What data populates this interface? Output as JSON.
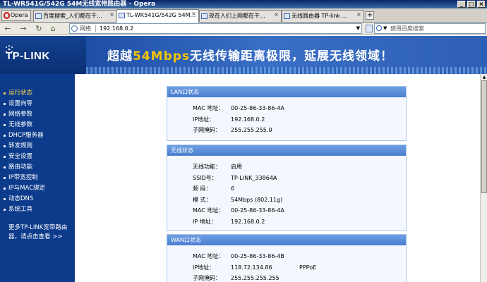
{
  "window": {
    "title": "TL-WR541G/542G 54M无线宽带路由器 - Opera"
  },
  "browser": {
    "opera_button": "Opera",
    "tabs": [
      {
        "label": "百度搜索_人们都在千..."
      },
      {
        "label": "TL-WR541G/542G 54M..."
      },
      {
        "label": "现在人们上网都在干..."
      },
      {
        "label": "无线路由器 TP-link ..."
      }
    ],
    "address": {
      "label": "网络",
      "url": "192.168.0.2"
    },
    "search": {
      "placeholder": "使用百度搜索"
    }
  },
  "banner": {
    "logo": "TP-LINK",
    "slogan_prefix": "超越",
    "slogan_highlight": "54Mbps",
    "slogan_suffix": "无线传输距离极限，延展无线领域！"
  },
  "sidebar": {
    "items": [
      {
        "label": "运行状态"
      },
      {
        "label": "设置向导"
      },
      {
        "label": "网络参数"
      },
      {
        "label": "无线参数"
      },
      {
        "label": "DHCP服务器"
      },
      {
        "label": "转发规则"
      },
      {
        "label": "安全设置"
      },
      {
        "label": "路由功能"
      },
      {
        "label": "IP带宽控制"
      },
      {
        "label": "IP与MAC绑定"
      },
      {
        "label": "动态DNS"
      },
      {
        "label": "系统工具"
      }
    ],
    "more": "更多TP-LINK宽带路由器，请点击查看 >>"
  },
  "panels": {
    "lan": {
      "title": "LAN口状态",
      "rows": [
        {
          "key": "MAC 地址：",
          "value": "00-25-86-33-86-4A"
        },
        {
          "key": "IP地址：",
          "value": "192.168.0.2"
        },
        {
          "key": "子网掩码：",
          "value": "255.255.255.0"
        }
      ]
    },
    "wireless": {
      "title": "无线状态",
      "rows": [
        {
          "key": "无线功能：",
          "value": "启用"
        },
        {
          "key": "SSID号：",
          "value": "TP-LINK_33864A"
        },
        {
          "key": "频 段：",
          "value": "6"
        },
        {
          "key": "模 式：",
          "value": "54Mbps (802.11g)"
        },
        {
          "key": "MAC 地址：",
          "value": "00-25-86-33-86-4A"
        },
        {
          "key": "IP 地址：",
          "value": "192.168.0.2"
        }
      ]
    },
    "wan": {
      "title": "WAN口状态",
      "rows": [
        {
          "key": "MAC 地址：",
          "value": "00-25-86-33-86-4B"
        },
        {
          "key": "IP地址：",
          "value": "118.72.134.86",
          "extra": "PPPoE"
        },
        {
          "key": "子网掩码：",
          "value": "255.255.255.255"
        }
      ]
    }
  }
}
